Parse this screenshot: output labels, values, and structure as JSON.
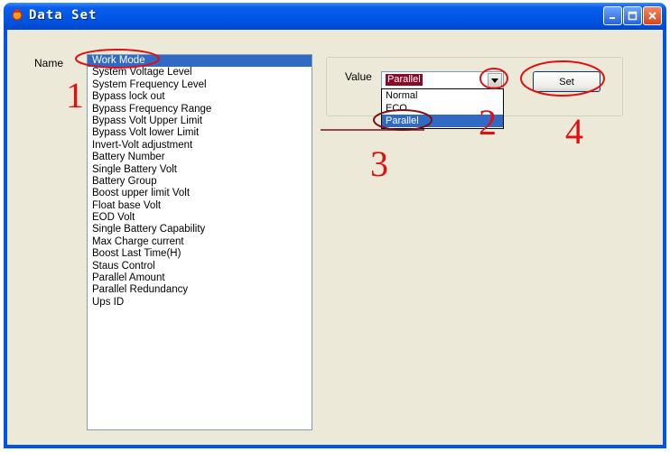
{
  "window": {
    "title": "Data Set",
    "icons": {
      "app": "app-icon",
      "minimize": "minimize-icon",
      "maximize": "maximize-icon",
      "close": "close-icon"
    }
  },
  "form": {
    "name_label": "Name",
    "items": [
      {
        "label": "Work Mode",
        "selected": true
      },
      {
        "label": "System Voltage Level"
      },
      {
        "label": "System Frequency Level"
      },
      {
        "label": "Bypass lock out"
      },
      {
        "label": "Bypass Frequency Range"
      },
      {
        "label": "Bypass Volt Upper Limit"
      },
      {
        "label": "Bypass Volt lower Limit"
      },
      {
        "label": "Invert-Volt adjustment"
      },
      {
        "label": "Battery Number"
      },
      {
        "label": "Single Battery Volt"
      },
      {
        "label": "Battery Group"
      },
      {
        "label": "Boost upper limit Volt"
      },
      {
        "label": "Float base Volt"
      },
      {
        "label": "EOD Volt"
      },
      {
        "label": "Single Battery Capability"
      },
      {
        "label": "Max Charge current"
      },
      {
        "label": "Boost Last Time(H)"
      },
      {
        "label": "Staus Control"
      },
      {
        "label": "Parallel Amount"
      },
      {
        "label": "Parallel Redundancy"
      },
      {
        "label": "Ups ID"
      }
    ],
    "value_label": "Value",
    "value_selected": "Parallel",
    "value_options": [
      {
        "label": "Normal"
      },
      {
        "label": "ECO"
      },
      {
        "label": "Parallel",
        "selected": true
      }
    ],
    "set_label": "Set"
  },
  "annotations": {
    "step1": "1",
    "step2": "2",
    "step3": "3",
    "step4": "4",
    "color": "#e01010"
  }
}
